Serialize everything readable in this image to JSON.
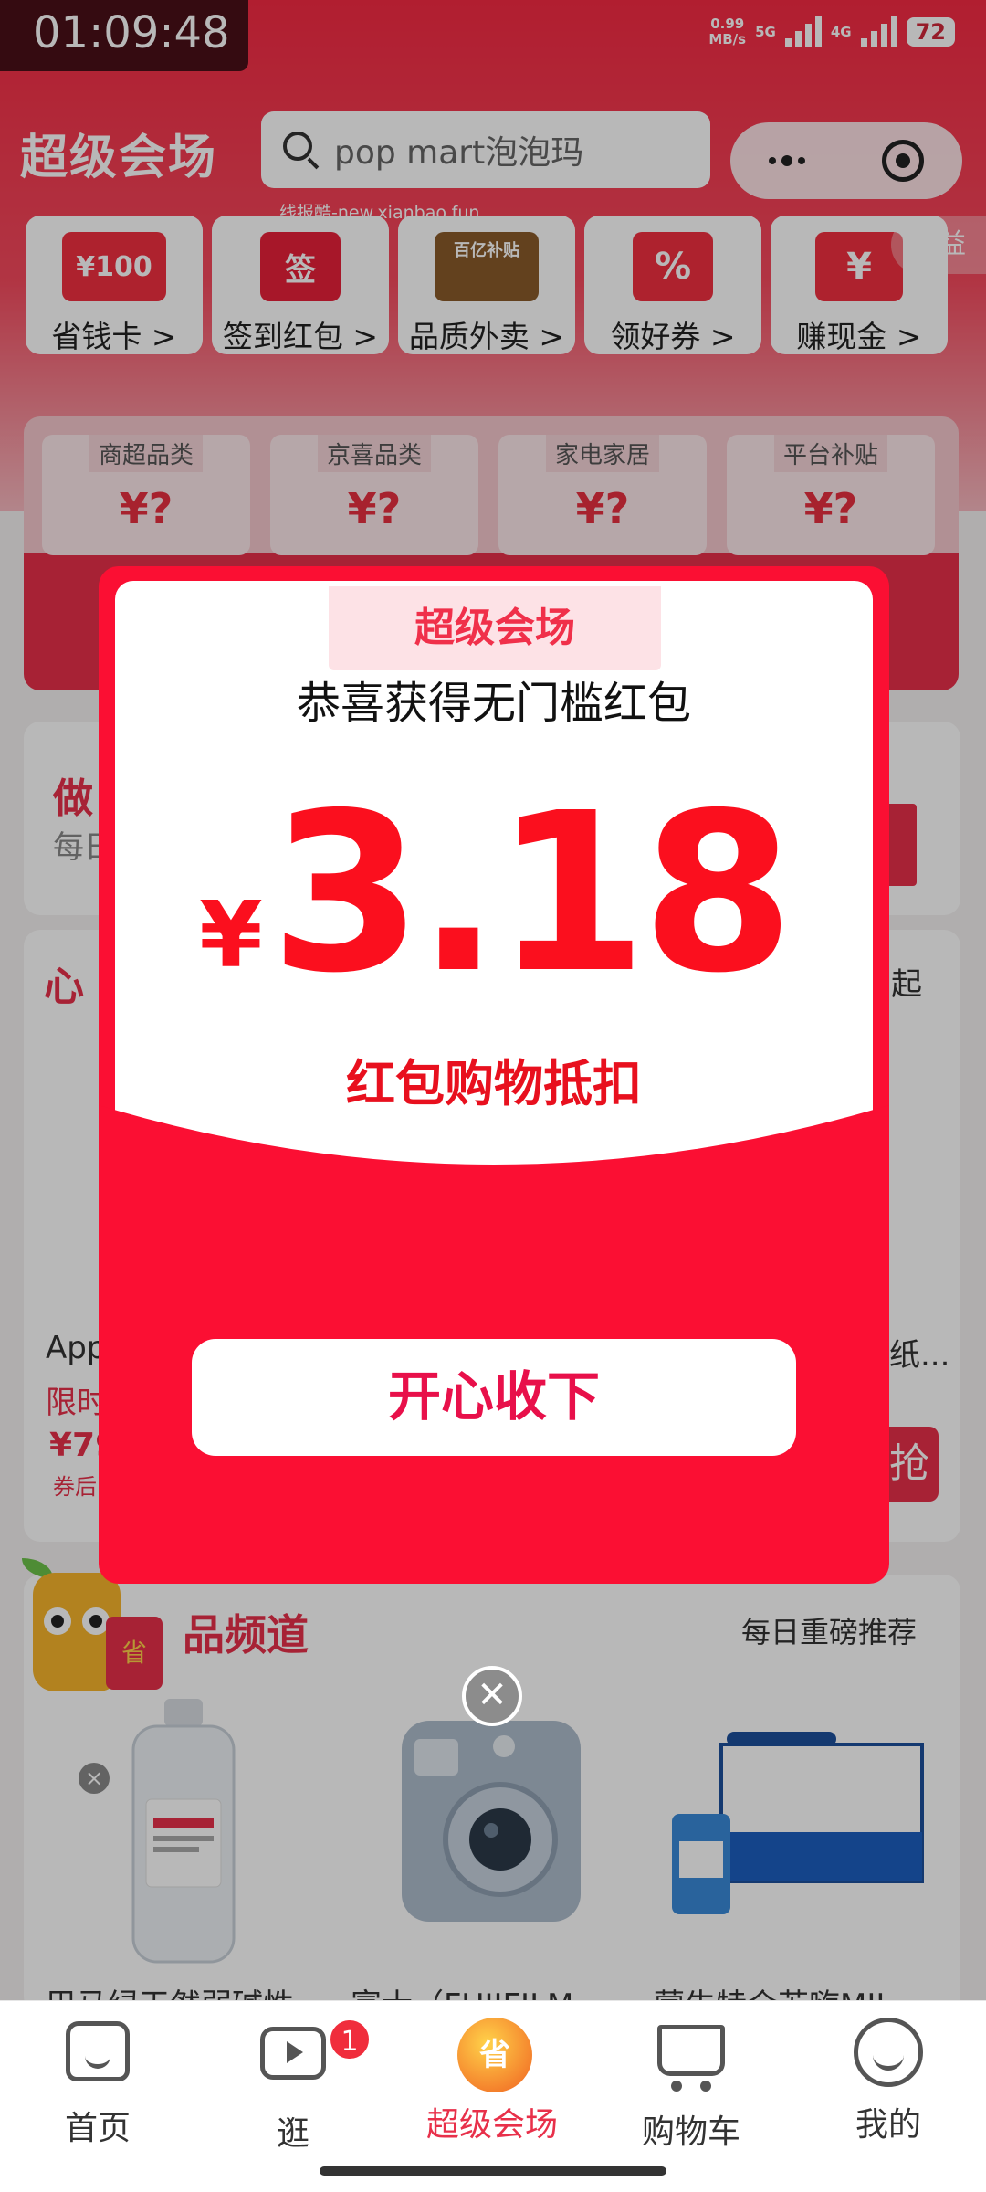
{
  "status_bar": {
    "time": "01:09:48",
    "net_speed_value": "0.99",
    "net_speed_unit": "MB/s",
    "network_1": "5G",
    "network_2": "4G",
    "battery": "72"
  },
  "header": {
    "title": "超级会场",
    "search_text": "pop mart泡泡玛",
    "watermark": "线报酷-new.xianbao.fun"
  },
  "quick_links": [
    {
      "label": "省钱卡 >",
      "icon_text": "¥100",
      "icon": "coupon-card-icon"
    },
    {
      "label": "签到红包 >",
      "icon_text": "签",
      "icon": "signin-envelope-icon"
    },
    {
      "label": "品质外卖 >",
      "icon_text": "百亿补贴",
      "icon": "takeout-burger-icon"
    },
    {
      "label": "领好券 >",
      "icon_text": "%",
      "icon": "coupon-percent-icon"
    },
    {
      "label": "赚现金 >",
      "icon_text": "¥",
      "icon": "cash-envelope-icon"
    }
  ],
  "quanyi_label": "权益",
  "categories": [
    {
      "name": "商超品类",
      "value": "¥?"
    },
    {
      "name": "京喜品类",
      "value": "¥?"
    },
    {
      "name": "家电家居",
      "value": "¥?"
    },
    {
      "name": "平台补贴",
      "value": "¥?"
    }
  ],
  "background_fragments": {
    "task_title": "做",
    "task_sub": "每日",
    "section_title": "心",
    "section_right": "起",
    "product_name": "App",
    "product_tag": "限时",
    "product_price": "¥79",
    "product_note": "券后",
    "right_product": "纸...",
    "right_button": "抢"
  },
  "channel": {
    "title": "品频道",
    "right_text": "每日重磅推荐",
    "mascot_text": "省",
    "products": [
      {
        "name": "巴马绿天然弱碱性",
        "icon": "water-bottle-icon"
      },
      {
        "name": "富士（FUJIFILM",
        "icon": "instant-camera-icon"
      },
      {
        "name": "蒙牛特仑苏嗨MIL",
        "icon": "milk-box-icon"
      }
    ]
  },
  "modal": {
    "tag": "超级会场",
    "headline": "恭喜获得无门槛红包",
    "currency": "¥",
    "amount": "3.18",
    "subtitle": "红包购物抵扣",
    "accept_label": "开心收下",
    "close_symbol": "✕"
  },
  "bottom_nav": [
    {
      "label": "首页",
      "icon": "home-icon"
    },
    {
      "label": "逛",
      "icon": "video-icon",
      "badge": "1"
    },
    {
      "label": "超级会场",
      "icon": "super-venue-icon",
      "icon_text": "省"
    },
    {
      "label": "购物车",
      "icon": "cart-icon"
    },
    {
      "label": "我的",
      "icon": "profile-icon"
    }
  ],
  "colors": {
    "brand_red": "#fb0f33",
    "amount_red": "#fb0f1e",
    "accept_text": "#e8104a"
  }
}
